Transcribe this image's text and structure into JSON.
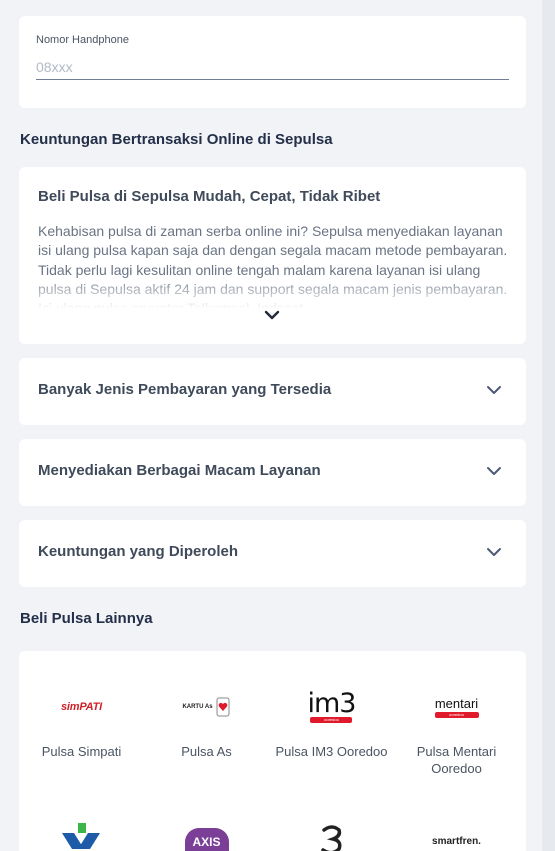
{
  "phone_form": {
    "label": "Nomor Handphone",
    "placeholder": "08xxx",
    "value": ""
  },
  "benefits_section": {
    "title": "Keuntungan Bertransaksi Online di Sepulsa",
    "article": {
      "title": "Beli Pulsa di Sepulsa Mudah, Cepat, Tidak Ribet",
      "body": "Kehabisan pulsa di zaman serba online ini? Sepulsa menyediakan layanan isi ulang pulsa kapan saja dan dengan segala macam metode pembayaran. Tidak perlu lagi kesulitan online tengah malam karena layanan isi ulang pulsa di Sepulsa aktif 24 jam dan support segala macam jenis pembayaran. Isi ulang pulsa operator Telkomsel, Indosat"
    },
    "accordion": [
      {
        "label": "Banyak Jenis Pembayaran yang Tersedia"
      },
      {
        "label": "Menyediakan Berbagai Macam Layanan"
      },
      {
        "label": "Keuntungan yang Diperoleh"
      }
    ]
  },
  "other_pulsa": {
    "title": "Beli Pulsa Lainnya",
    "operators": [
      {
        "label": "Pulsa Simpati",
        "logo_text": "simPATI",
        "icon": "simpati-logo"
      },
      {
        "label": "Pulsa As",
        "logo_text": "KARTU As",
        "icon": "kartu-as-logo"
      },
      {
        "label": "Pulsa IM3 Ooredoo",
        "logo_text": "im3",
        "logo_sub": "ooredoo",
        "icon": "im3-logo"
      },
      {
        "label": "Pulsa Mentari Ooredoo",
        "logo_text": "mentari",
        "logo_sub": "ooredoo",
        "icon": "mentari-logo"
      },
      {
        "label": "",
        "logo_text": "",
        "icon": "xl-logo"
      },
      {
        "label": "",
        "logo_text": "AXIS",
        "icon": "axis-logo"
      },
      {
        "label": "",
        "logo_text": "",
        "icon": "three-logo"
      },
      {
        "label": "",
        "logo_text": "smartfren.",
        "icon": "smartfren-logo"
      }
    ]
  },
  "colors": {
    "page_background": "#f1f3f6",
    "card_background": "#ffffff",
    "heading": "#243049",
    "text": "#3f4a5a",
    "chevron": "#4d5a75",
    "brand_red": "#e11a2b",
    "axis_purple": "#7b3f98",
    "xl_blue": "#1d5aa8",
    "xl_green": "#3cb64a"
  }
}
